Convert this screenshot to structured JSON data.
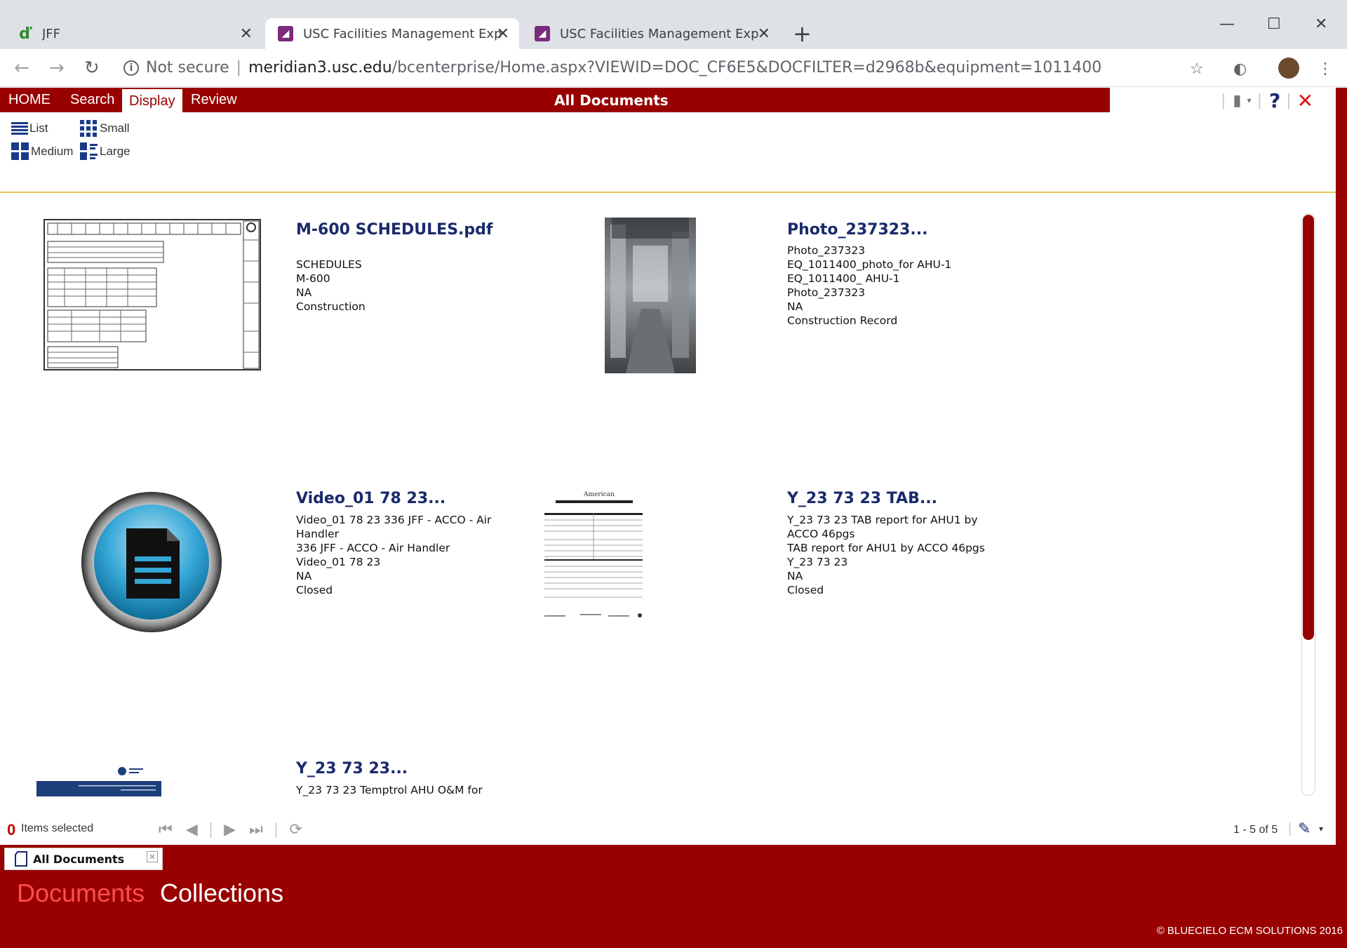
{
  "browser": {
    "tabs": [
      {
        "title": "JFF",
        "favicon": "jff-logo-icon"
      },
      {
        "title": "USC Facilities Management Explo",
        "favicon": "meridian-icon"
      },
      {
        "title": "USC Facilities Management Explo",
        "favicon": "meridian-icon"
      }
    ],
    "address": {
      "security": "Not secure",
      "host": "meridian3.usc.edu",
      "path": "/bcenterprise/Home.aspx?VIEWID=DOC_CF6E5&DOCFILTER=d2968b&equipment=1011400"
    }
  },
  "app": {
    "menu": [
      "HOME",
      "Search",
      "Display",
      "Review"
    ],
    "active_menu": "Display",
    "title": "All Documents",
    "view_options": [
      "List",
      "Small",
      "Medium",
      "Large"
    ]
  },
  "documents": [
    {
      "title": "M-600 SCHEDULES.pdf",
      "lines": [
        "SCHEDULES",
        "M-600",
        "NA",
        "Construction"
      ]
    },
    {
      "title": "Photo_237323...",
      "lines": [
        "Photo_237323",
        "EQ_1011400_photo_for AHU-1",
        "EQ_1011400_ AHU-1",
        "Photo_237323",
        "NA",
        "Construction Record"
      ]
    },
    {
      "title": "Video_01 78 23...",
      "lines": [
        "Video_01 78 23 336 JFF - ACCO - Air",
        "Handler",
        "336 JFF - ACCO - Air Handler",
        "Video_01 78 23",
        "NA",
        "Closed"
      ]
    },
    {
      "title": "Y_23 73 23 TAB...",
      "lines": [
        "Y_23 73 23 TAB report for AHU1 by",
        "ACCO 46pgs",
        "TAB report for AHU1 by ACCO 46pgs",
        "Y_23 73 23",
        "NA",
        "Closed"
      ]
    },
    {
      "title": "Y_23 73 23...",
      "lines": [
        "Y_23 73 23 Temptrol AHU O&M for"
      ]
    }
  ],
  "status": {
    "selected_count": "0",
    "selected_label": "Items selected",
    "range": "1 - 5 of 5"
  },
  "footer": {
    "open_tab": "All Documents",
    "section_tabs": [
      "Documents",
      "Collections"
    ],
    "active_section": "Documents",
    "copyright": "© BLUECIELO ECM SOLUTIONS 2016"
  },
  "colors": {
    "brand": "#990000",
    "title_blue": "#1a2a6c",
    "active_section": "#ff4d4d"
  }
}
